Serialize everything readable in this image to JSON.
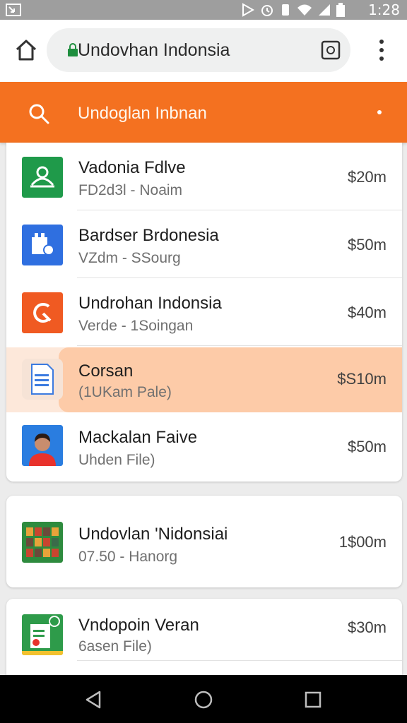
{
  "status_bar": {
    "time": "1:28",
    "icons": [
      "notification-icon",
      "play-icon",
      "alarm-icon",
      "vibrate-icon",
      "wifi-icon",
      "signal-icon",
      "battery-icon"
    ]
  },
  "browser": {
    "url_text": "Undovhan Indonsia",
    "icons": [
      "home-icon",
      "lock-icon",
      "tabs-icon",
      "more-vert-icon"
    ]
  },
  "app_bar": {
    "title": "Undoglan Inbnan",
    "color": "#f47120",
    "icons": [
      "search-icon"
    ]
  },
  "list": [
    {
      "title": "Vadonia Fdlve",
      "subtitle": "FD2d3l - Noaim",
      "price": "$20m",
      "icon": "green-app-icon",
      "color": "#1f9a4a",
      "highlighted": false
    },
    {
      "title": "Bardser Brdonesia",
      "subtitle": "VZdm - SSourg",
      "price": "$50m",
      "icon": "blue-app-icon",
      "color": "#2f6fe0",
      "highlighted": false
    },
    {
      "title": "Undrohan Indonsia",
      "subtitle": "Verde - 1Soingan",
      "price": "$40m",
      "icon": "orange-app-icon",
      "color": "#f05a22",
      "highlighted": false
    },
    {
      "title": "Corsan",
      "subtitle": "(1UKam Pale)",
      "price": "$S10m",
      "icon": "document-icon",
      "color": "#fdcba8",
      "highlighted": true
    },
    {
      "title": "Mackalan Faive",
      "subtitle": "Uhden File)",
      "price": "$50m",
      "icon": "avatar-icon",
      "color": "#2a7de0",
      "highlighted": false
    }
  ],
  "list2": [
    {
      "title": "Undovlan 'Nidonsiai",
      "subtitle": "07.50 - Hanorg",
      "price": "1$00m",
      "icon": "grid-app-icon",
      "color": "#2e8b3e",
      "highlighted": false
    }
  ],
  "list3": [
    {
      "title": "Vndopoin Veran",
      "subtitle": "6asen File)",
      "price": "$30m",
      "icon": "sheet-app-icon",
      "color": "#2e9b4a",
      "highlighted": false
    }
  ],
  "nav": {
    "icons": [
      "back-icon",
      "home-circle-icon",
      "recents-icon"
    ]
  }
}
